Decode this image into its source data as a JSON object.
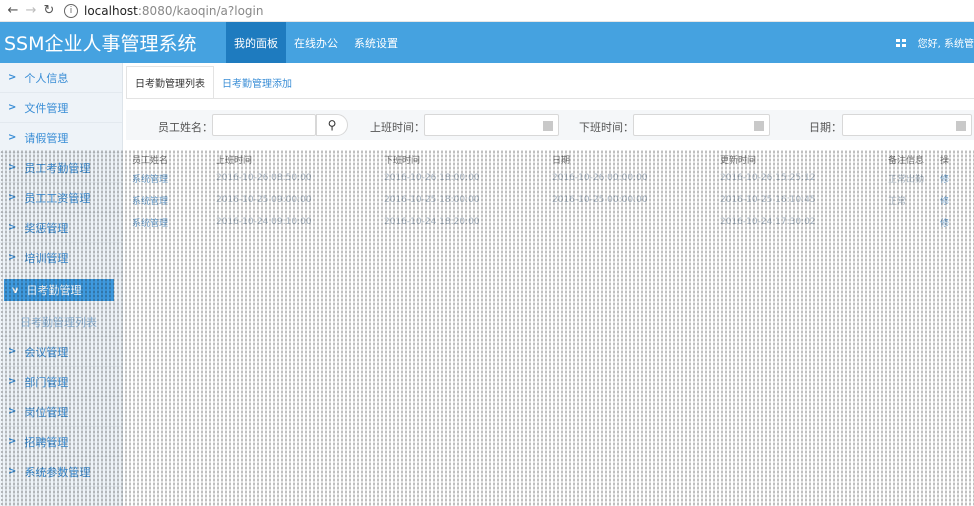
{
  "browser": {
    "url_host": "localhost",
    "url_rest": ":8080/kaoqin/a?login"
  },
  "app": {
    "title": "SSM企业人事管理系统",
    "nav": [
      {
        "label": "我的面板",
        "active": true
      },
      {
        "label": "在线办公",
        "active": false
      },
      {
        "label": "系统设置",
        "active": false
      }
    ],
    "greeting": "您好, 系统管"
  },
  "sidebar": {
    "items": [
      {
        "label": "个人信息"
      },
      {
        "label": "文件管理"
      },
      {
        "label": "请假管理"
      },
      {
        "label": "员工考勤管理"
      },
      {
        "label": "员工工资管理"
      },
      {
        "label": "奖惩管理"
      },
      {
        "label": "培训管理"
      },
      {
        "label": "日考勤管理"
      },
      {
        "label": "日考勤管理列表"
      },
      {
        "label": "会议管理"
      },
      {
        "label": "部门管理"
      },
      {
        "label": "岗位管理"
      },
      {
        "label": "招聘管理"
      },
      {
        "label": "系统参数管理"
      }
    ]
  },
  "tabs": [
    {
      "label": "日考勤管理列表",
      "active": true
    },
    {
      "label": "日考勤管理添加",
      "active": false
    }
  ],
  "search": {
    "name_label": "员工姓名：",
    "on_label": "上班时间：",
    "off_label": "下班时间：",
    "date_label": "日期："
  },
  "table": {
    "headers": [
      "员工姓名",
      "上班时间",
      "下班时间",
      "日期",
      "更新时间",
      "备注信息",
      "操"
    ],
    "rows": [
      [
        "系统管理",
        "2016-10-26 08:50:00",
        "2016-10-26 18:00:00",
        "2016-10-26 00:00:00",
        "2016-10-26 15:25:12",
        "正常出勤",
        "修"
      ],
      [
        "系统管理",
        "2016-10-25 09:00:00",
        "2016-10-25 18:00:00",
        "2016-10-25 00:00:00",
        "2016-10-25 16:10:45",
        "正常",
        "修"
      ],
      [
        "系统管理",
        "2016-10-24 09:10:00",
        "2016-10-24 18:20:00",
        "",
        "2016-10-24 17:30:02",
        "",
        "修"
      ]
    ]
  }
}
